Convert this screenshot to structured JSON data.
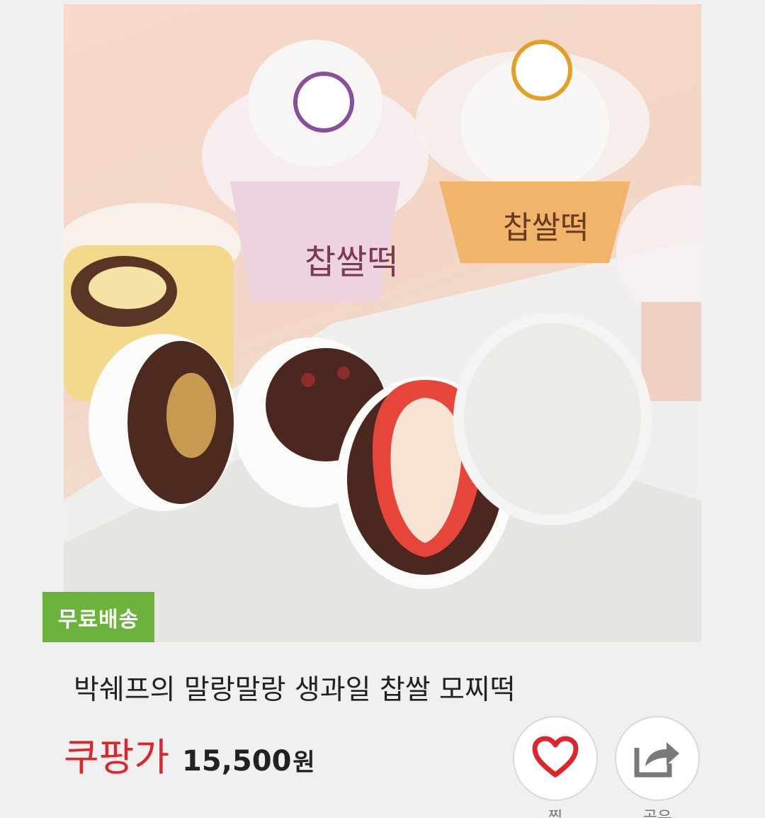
{
  "product": {
    "badge": "무료배송",
    "title": "박쉐프의 말랑말랑 생과일 찹쌀 모찌떡",
    "price_label": "쿠팡가",
    "price": "15,500",
    "price_unit": "원"
  },
  "actions": {
    "like_label": "찜",
    "share_label": "공유"
  },
  "colors": {
    "badge_green": "#6cb33e",
    "price_red": "#e0242b",
    "heart_red": "#e0242b",
    "share_gray": "#7a7a7a"
  },
  "icons": {
    "like": "heart-icon",
    "share": "share-icon"
  }
}
